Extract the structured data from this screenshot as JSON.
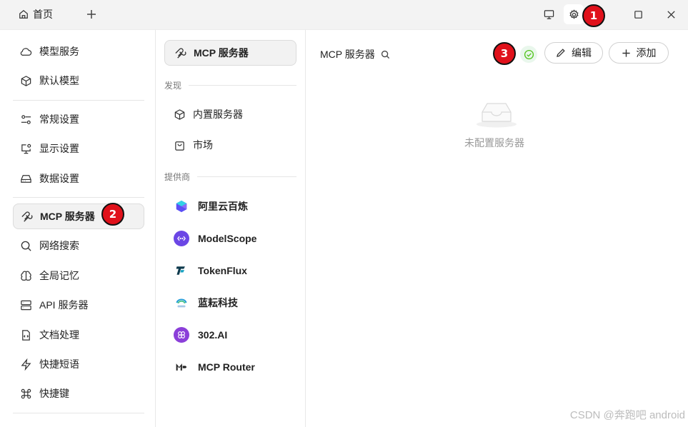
{
  "titlebar": {
    "home_tab_label": "首页",
    "new_tab_icon": "plus-icon",
    "icons": [
      "monitor-icon",
      "gear-icon",
      "maximize-icon",
      "close-icon"
    ]
  },
  "badges": {
    "one": "1",
    "two": "2",
    "three": "3"
  },
  "sidebar": {
    "items": [
      {
        "label": "模型服务",
        "icon": "cloud-icon"
      },
      {
        "label": "默认模型",
        "icon": "cube-icon"
      },
      {
        "label": "常规设置",
        "icon": "sliders-icon"
      },
      {
        "label": "显示设置",
        "icon": "monitor-settings-icon"
      },
      {
        "label": "数据设置",
        "icon": "hard-drive-icon"
      },
      {
        "label": "MCP 服务器",
        "icon": "mcp-icon",
        "active": true
      },
      {
        "label": "网络搜索",
        "icon": "search-icon"
      },
      {
        "label": "全局记忆",
        "icon": "brain-icon"
      },
      {
        "label": "API 服务器",
        "icon": "server-icon"
      },
      {
        "label": "文档处理",
        "icon": "file-code-icon"
      },
      {
        "label": "快捷短语",
        "icon": "zap-icon"
      },
      {
        "label": "快捷键",
        "icon": "command-icon"
      }
    ]
  },
  "midpanel": {
    "top_item": "MCP 服务器",
    "discover_label": "发现",
    "discover_items": [
      {
        "label": "内置服务器",
        "icon": "cube-icon"
      },
      {
        "label": "市场",
        "icon": "shopping-bag-icon"
      }
    ],
    "providers_label": "提供商",
    "providers": [
      {
        "label": "阿里云百炼",
        "icon": "bailian-logo-icon"
      },
      {
        "label": "ModelScope",
        "icon": "modelscope-logo-icon"
      },
      {
        "label": "TokenFlux",
        "icon": "tokenflux-logo-icon"
      },
      {
        "label": "蓝耘科技",
        "icon": "lanyun-logo-icon"
      },
      {
        "label": "302.AI",
        "icon": "302ai-logo-icon"
      },
      {
        "label": "MCP Router",
        "icon": "mcp-router-logo-icon"
      }
    ]
  },
  "content": {
    "title": "MCP 服务器",
    "edit_label": "编辑",
    "add_label": "添加",
    "empty_text": "未配置服务器"
  },
  "watermark": "CSDN @奔跑吧 android",
  "colors": {
    "badge": "#e0111b",
    "status": "#52c41a",
    "accent": "#6b46e5"
  }
}
